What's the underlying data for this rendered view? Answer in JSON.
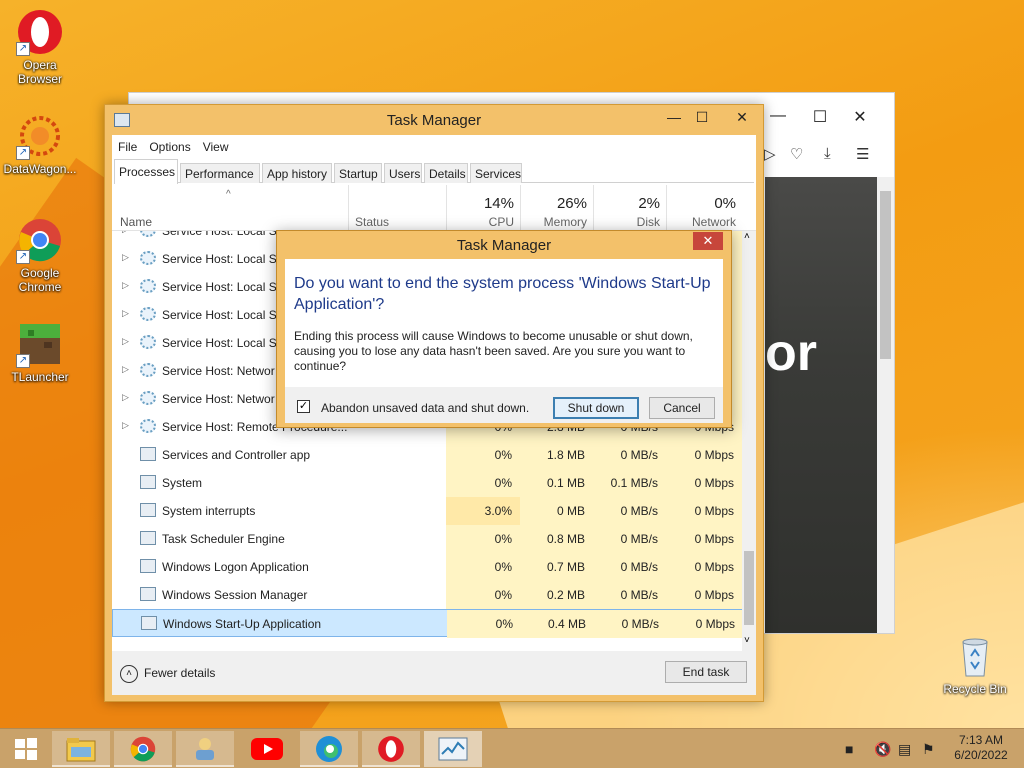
{
  "desktop": {
    "icons": [
      {
        "label": "Opera Browser",
        "icon": "opera-icon"
      },
      {
        "label": "DataWagon...",
        "icon": "datawagon-icon"
      },
      {
        "label": "Google Chrome",
        "icon": "chrome-icon"
      },
      {
        "label": "TLauncher",
        "icon": "tlauncher-icon"
      },
      {
        "label": "Recycle Bin",
        "icon": "recycle-bin-icon"
      }
    ]
  },
  "browser": {
    "overlay_text": "or"
  },
  "task_manager": {
    "title": "Task Manager",
    "menu": [
      "File",
      "Options",
      "View"
    ],
    "tabs": [
      "Processes",
      "Performance",
      "App history",
      "Startup",
      "Users",
      "Details",
      "Services"
    ],
    "active_tab": "Processes",
    "columns": {
      "name": "Name",
      "status": "Status",
      "cpu": {
        "label": "CPU",
        "total": "14%"
      },
      "memory": {
        "label": "Memory",
        "total": "26%"
      },
      "disk": {
        "label": "Disk",
        "total": "2%"
      },
      "network": {
        "label": "Network",
        "total": "0%"
      }
    },
    "rows": [
      {
        "name": "Service Host: Local Se",
        "expandable": true,
        "icon": "gear",
        "cpu": "",
        "mem": "",
        "disk": "",
        "net": ""
      },
      {
        "name": "Service Host: Local Se",
        "expandable": true,
        "icon": "gear",
        "cpu": "",
        "mem": "",
        "disk": "",
        "net": ""
      },
      {
        "name": "Service Host: Local Se",
        "expandable": true,
        "icon": "gear",
        "cpu": "",
        "mem": "",
        "disk": "",
        "net": ""
      },
      {
        "name": "Service Host: Local Sy",
        "expandable": true,
        "icon": "gear",
        "cpu": "",
        "mem": "",
        "disk": "",
        "net": ""
      },
      {
        "name": "Service Host: Local Sy",
        "expandable": true,
        "icon": "gear",
        "cpu": "",
        "mem": "",
        "disk": "",
        "net": ""
      },
      {
        "name": "Service Host: Networ",
        "expandable": true,
        "icon": "gear",
        "cpu": "",
        "mem": "",
        "disk": "",
        "net": ""
      },
      {
        "name": "Service Host: Networ",
        "expandable": true,
        "icon": "gear",
        "cpu": "",
        "mem": "",
        "disk": "",
        "net": ""
      },
      {
        "name": "Service Host: Remote Procedure...",
        "expandable": true,
        "icon": "gear",
        "cpu": "0%",
        "mem": "2.8 MB",
        "disk": "0 MB/s",
        "net": "0 Mbps"
      },
      {
        "name": "Services and Controller app",
        "expandable": false,
        "icon": "app",
        "cpu": "0%",
        "mem": "1.8 MB",
        "disk": "0 MB/s",
        "net": "0 Mbps"
      },
      {
        "name": "System",
        "expandable": false,
        "icon": "app",
        "cpu": "0%",
        "mem": "0.1 MB",
        "disk": "0.1 MB/s",
        "net": "0 Mbps"
      },
      {
        "name": "System interrupts",
        "expandable": false,
        "icon": "app",
        "cpu": "3.0%",
        "mem": "0 MB",
        "disk": "0 MB/s",
        "net": "0 Mbps"
      },
      {
        "name": "Task Scheduler Engine",
        "expandable": false,
        "icon": "app",
        "cpu": "0%",
        "mem": "0.8 MB",
        "disk": "0 MB/s",
        "net": "0 Mbps"
      },
      {
        "name": "Windows Logon Application",
        "expandable": false,
        "icon": "app",
        "cpu": "0%",
        "mem": "0.7 MB",
        "disk": "0 MB/s",
        "net": "0 Mbps"
      },
      {
        "name": "Windows Session Manager",
        "expandable": false,
        "icon": "app",
        "cpu": "0%",
        "mem": "0.2 MB",
        "disk": "0 MB/s",
        "net": "0 Mbps"
      },
      {
        "name": "Windows Start-Up Application",
        "expandable": false,
        "icon": "app",
        "cpu": "0%",
        "mem": "0.4 MB",
        "disk": "0 MB/s",
        "net": "0 Mbps",
        "selected": true
      }
    ],
    "fewer_details": "Fewer details",
    "end_task": "End task"
  },
  "dialog": {
    "title": "Task Manager",
    "question": "Do you want to end the system process 'Windows Start-Up Application'?",
    "message": "Ending this process will cause Windows to become unusable or shut down, causing you to lose any data hasn't been saved. Are you sure you want to continue?",
    "checkbox_label": "Abandon unsaved data and shut down.",
    "checkbox_checked": true,
    "primary_button": "Shut down",
    "cancel_button": "Cancel",
    "close_glyph": "✕"
  },
  "taskbar": {
    "items": [
      "start-icon",
      "file-explorer-icon",
      "chrome-icon",
      "people-icon",
      "youtube-icon",
      "edge-icon",
      "opera-icon",
      "task-manager-icon"
    ],
    "clock_time": "7:13 AM",
    "clock_date": "6/20/2022"
  }
}
